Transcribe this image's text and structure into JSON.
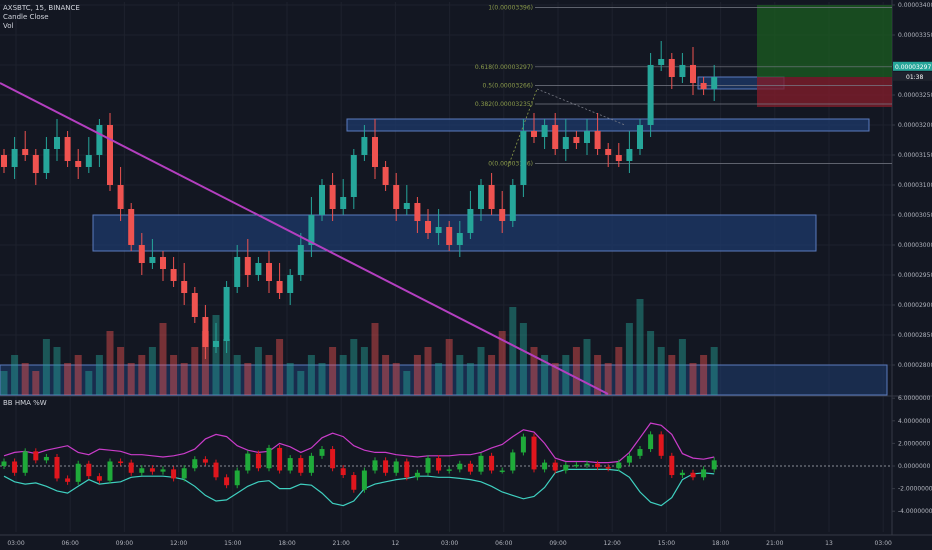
{
  "header": {
    "symbol_line": "AXSBTC, 15, BINANCE",
    "study1": "Candle Close",
    "study2": "Vol"
  },
  "indicator": {
    "title": "BB HMA %W"
  },
  "colors": {
    "background": "#131722",
    "up": "#26a69a",
    "down": "#ef5350",
    "zone": "#1e3a6b",
    "trendline": "#b43fc0",
    "fib": "#8f9f4a",
    "target": "#1b5e20",
    "stop": "#7f1d2a",
    "osc_up": "#1faa3a",
    "osc_down": "#e0161d",
    "band_upper": "#c93cc9",
    "band_lower": "#3fd0c0"
  },
  "chart_data": [
    {
      "type": "candlestick",
      "title": "AXSBTC, 15, BINANCE",
      "xaxis": {
        "ticks": [
          "03:00",
          "06:00",
          "09:00",
          "12:00",
          "15:00",
          "18:00",
          "21:00",
          "12",
          "03:00",
          "06:00",
          "09:00",
          "12:00",
          "15:00",
          "18:00",
          "21:00",
          "13",
          "03:00"
        ]
      },
      "yaxis": {
        "range": [
          2.79e-05,
          3.4e-05
        ],
        "ticks": [
          "0.00003400",
          "0.00003350",
          "0.00003300",
          "0.00003250",
          "0.00003200",
          "0.00003150",
          "0.00003100",
          "0.00003050",
          "0.00003000",
          "0.00002950",
          "0.00002900",
          "0.00002850",
          "0.00002800"
        ]
      },
      "last_price": "0.00003297",
      "countdown": "01:38",
      "fib_levels": [
        {
          "label": "1(0.00003396)",
          "value": 3.396e-05
        },
        {
          "label": "0.618(0.00003297)",
          "value": 3.297e-05
        },
        {
          "label": "0.5(0.00003266)",
          "value": 3.266e-05
        },
        {
          "label": "0.382(0.00003235)",
          "value": 3.235e-05
        },
        {
          "label": "0(0.00003136)",
          "value": 3.136e-05
        }
      ],
      "zones": [
        {
          "from": 2.99e-05,
          "to": 3.05e-05
        },
        {
          "from": 3.19e-05,
          "to": 3.21e-05
        },
        {
          "from": 3.26e-05,
          "to": 3.28e-05
        }
      ],
      "position": {
        "target": 3.4e-05,
        "entry": 3.28e-05,
        "stop": 3.23e-05
      },
      "trendline": {
        "from": 3.27e-05,
        "to": 2.79e-05
      },
      "approx_close_path": [
        3.13,
        3.16,
        3.15,
        3.12,
        3.16,
        3.18,
        3.14,
        3.13,
        3.15,
        3.2,
        3.1,
        3.06,
        3.0,
        2.97,
        2.98,
        2.96,
        2.94,
        2.92,
        2.88,
        2.83,
        2.84,
        2.93,
        2.98,
        2.95,
        2.97,
        2.94,
        2.92,
        2.95,
        3.0,
        3.05,
        3.1,
        3.06,
        3.08,
        3.15,
        3.18,
        3.13,
        3.1,
        3.06,
        3.07,
        3.04,
        3.02,
        3.03,
        3.0,
        3.02,
        3.06,
        3.1,
        3.06,
        3.04,
        3.1,
        3.19,
        3.18,
        3.2,
        3.16,
        3.18,
        3.17,
        3.19,
        3.16,
        3.15,
        3.14,
        3.16,
        3.2,
        3.3,
        3.31,
        3.28,
        3.3,
        3.27,
        3.26,
        3.28
      ],
      "volume_approx": [
        3,
        5,
        4,
        3,
        7,
        6,
        4,
        5,
        3,
        5,
        8,
        6,
        4,
        5,
        6,
        9,
        5,
        4,
        6,
        8,
        10,
        7,
        5,
        4,
        6,
        5,
        7,
        4,
        3,
        5,
        4,
        6,
        5,
        7,
        6,
        9,
        5,
        4,
        3,
        5,
        6,
        4,
        7,
        5,
        4,
        6,
        5,
        8,
        11,
        9,
        6,
        5,
        4,
        5,
        6,
        7,
        5,
        4,
        6,
        9,
        12,
        8,
        6,
        5,
        7,
        4,
        5,
        6
      ]
    },
    {
      "type": "line",
      "title": "BB HMA %W",
      "yaxis": {
        "range": [
          -5,
          5
        ],
        "ticks": [
          "6.0000000",
          "4.0000000",
          "2.0000000",
          "0.0000000",
          "-2.0000000",
          "-4.0000000"
        ]
      },
      "series": [
        {
          "values": [
            0.4,
            -0.6,
            1.3,
            0.5,
            0.8,
            -1.1,
            -1.4,
            0.2,
            -0.9,
            -1.3,
            0.4,
            0.3,
            -0.6,
            -0.2,
            -0.5,
            -0.3,
            -1.1,
            -0.2,
            0.6,
            0.3,
            -1.0,
            -1.7,
            -0.4,
            1.1,
            -0.2,
            1.6,
            -0.4,
            0.7,
            -0.6,
            0.9,
            1.5,
            -0.2,
            -0.8,
            -2.1,
            -0.4,
            0.5,
            -0.6,
            0.4,
            -1.0,
            -0.6,
            0.7,
            -0.4,
            -0.3,
            0.2,
            -0.5,
            0.9,
            -0.4,
            -0.4,
            1.2,
            2.6,
            -0.3,
            0.3,
            -0.4,
            0.1,
            0.1,
            0.2,
            -0.1,
            -0.2,
            0.3,
            0.9,
            1.5,
            2.8,
            0.9,
            -0.8,
            -0.6,
            -1.0,
            -0.3,
            0.5
          ]
        },
        {
          "values": [
            0.9,
            1.2,
            1.3,
            1.1,
            1.4,
            1.6,
            1.8,
            1.2,
            1.0,
            1.5,
            1.4,
            1.3,
            1.0,
            1.0,
            0.9,
            0.8,
            0.9,
            1.1,
            1.5,
            2.4,
            2.8,
            2.6,
            1.8,
            1.4,
            1.2,
            1.3,
            2.0,
            1.7,
            1.2,
            1.6,
            2.5,
            2.9,
            2.6,
            1.8,
            1.4,
            1.2,
            1.2,
            1.0,
            0.9,
            0.8,
            0.9,
            0.9,
            0.9,
            1.0,
            1.0,
            1.2,
            1.6,
            1.9,
            2.6,
            3.2,
            3.0,
            2.0,
            0.7,
            0.4,
            0.4,
            0.4,
            0.3,
            0.3,
            0.4,
            1.2,
            2.5,
            3.8,
            3.6,
            2.8,
            1.1,
            0.7,
            0.6,
            0.8
          ]
        },
        {
          "values": [
            -0.9,
            -1.4,
            -1.6,
            -1.5,
            -1.8,
            -2.2,
            -2.4,
            -1.8,
            -1.2,
            -1.6,
            -1.5,
            -1.4,
            -1.0,
            -0.9,
            -0.9,
            -0.9,
            -1.0,
            -1.2,
            -1.8,
            -2.6,
            -3.1,
            -3.0,
            -2.4,
            -1.8,
            -1.4,
            -1.3,
            -2.0,
            -2.0,
            -1.6,
            -1.7,
            -2.4,
            -3.3,
            -3.5,
            -3.1,
            -2.0,
            -1.6,
            -1.4,
            -1.2,
            -1.1,
            -0.9,
            -0.9,
            -1.0,
            -1.0,
            -1.1,
            -1.2,
            -1.4,
            -1.8,
            -2.3,
            -2.6,
            -2.9,
            -2.7,
            -1.9,
            -0.6,
            -0.3,
            -0.3,
            -0.3,
            -0.3,
            -0.3,
            -0.4,
            -1.0,
            -2.3,
            -3.2,
            -3.5,
            -2.8,
            -1.2,
            -0.7,
            -0.6,
            -0.7
          ]
        }
      ]
    }
  ]
}
